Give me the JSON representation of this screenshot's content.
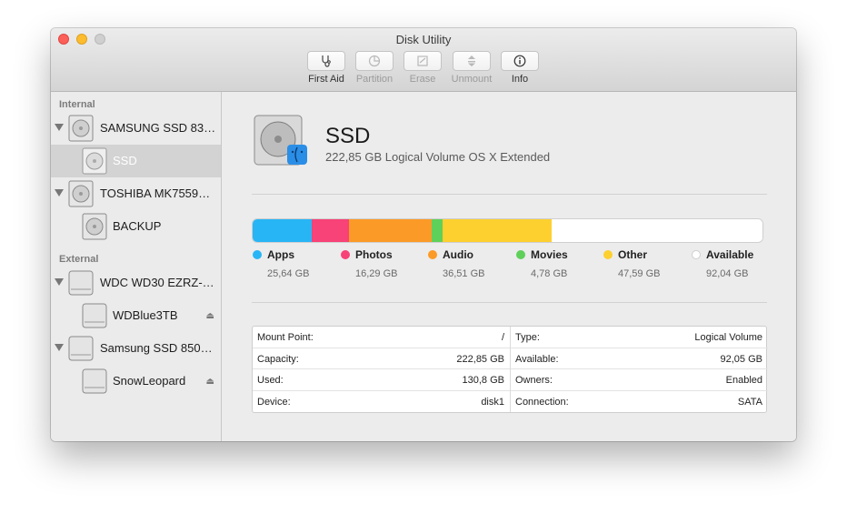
{
  "window": {
    "title": "Disk Utility"
  },
  "toolbar": {
    "first_aid": "First Aid",
    "partition": "Partition",
    "erase": "Erase",
    "unmount": "Unmount",
    "info": "Info"
  },
  "sidebar": {
    "internal_header": "Internal",
    "external_header": "External",
    "items": [
      {
        "label": "SAMSUNG SSD 83…",
        "kind": "disk",
        "icon": "internal-disk-icon"
      },
      {
        "label": "SSD",
        "kind": "volume",
        "icon": "volume-icon",
        "selected": true
      },
      {
        "label": "TOSHIBA MK7559…",
        "kind": "disk",
        "icon": "internal-disk-icon"
      },
      {
        "label": "BACKUP",
        "kind": "volume",
        "icon": "volume-icon"
      },
      {
        "label": "WDC WD30 EZRZ-…",
        "kind": "disk",
        "icon": "external-disk-icon"
      },
      {
        "label": "WDBlue3TB",
        "kind": "volume",
        "icon": "external-disk-icon",
        "eject": true
      },
      {
        "label": "Samsung SSD 850…",
        "kind": "disk",
        "icon": "external-disk-icon"
      },
      {
        "label": "SnowLeopard",
        "kind": "volume",
        "icon": "external-disk-icon",
        "eject": true
      }
    ]
  },
  "volume": {
    "name": "SSD",
    "description": "222,85 GB Logical Volume OS X Extended"
  },
  "usage": {
    "segments": [
      {
        "name": "Apps",
        "size": "25,64 GB",
        "gb": 25.64,
        "color": "#28b5f5"
      },
      {
        "name": "Photos",
        "size": "16,29 GB",
        "gb": 16.29,
        "color": "#f74377"
      },
      {
        "name": "Audio",
        "size": "36,51 GB",
        "gb": 36.51,
        "color": "#fc9a28"
      },
      {
        "name": "Movies",
        "size": "4,78 GB",
        "gb": 4.78,
        "color": "#5fd05a"
      },
      {
        "name": "Other",
        "size": "47,59 GB",
        "gb": 47.59,
        "color": "#fdd02f"
      },
      {
        "name": "Available",
        "size": "92,04 GB",
        "gb": 92.04,
        "color": "#ffffff"
      }
    ]
  },
  "info": {
    "left": [
      {
        "label": "Mount Point:",
        "value": "/"
      },
      {
        "label": "Capacity:",
        "value": "222,85 GB"
      },
      {
        "label": "Used:",
        "value": "130,8 GB"
      },
      {
        "label": "Device:",
        "value": "disk1"
      }
    ],
    "right": [
      {
        "label": "Type:",
        "value": "Logical Volume"
      },
      {
        "label": "Available:",
        "value": "92,05 GB"
      },
      {
        "label": "Owners:",
        "value": "Enabled"
      },
      {
        "label": "Connection:",
        "value": "SATA"
      }
    ]
  }
}
